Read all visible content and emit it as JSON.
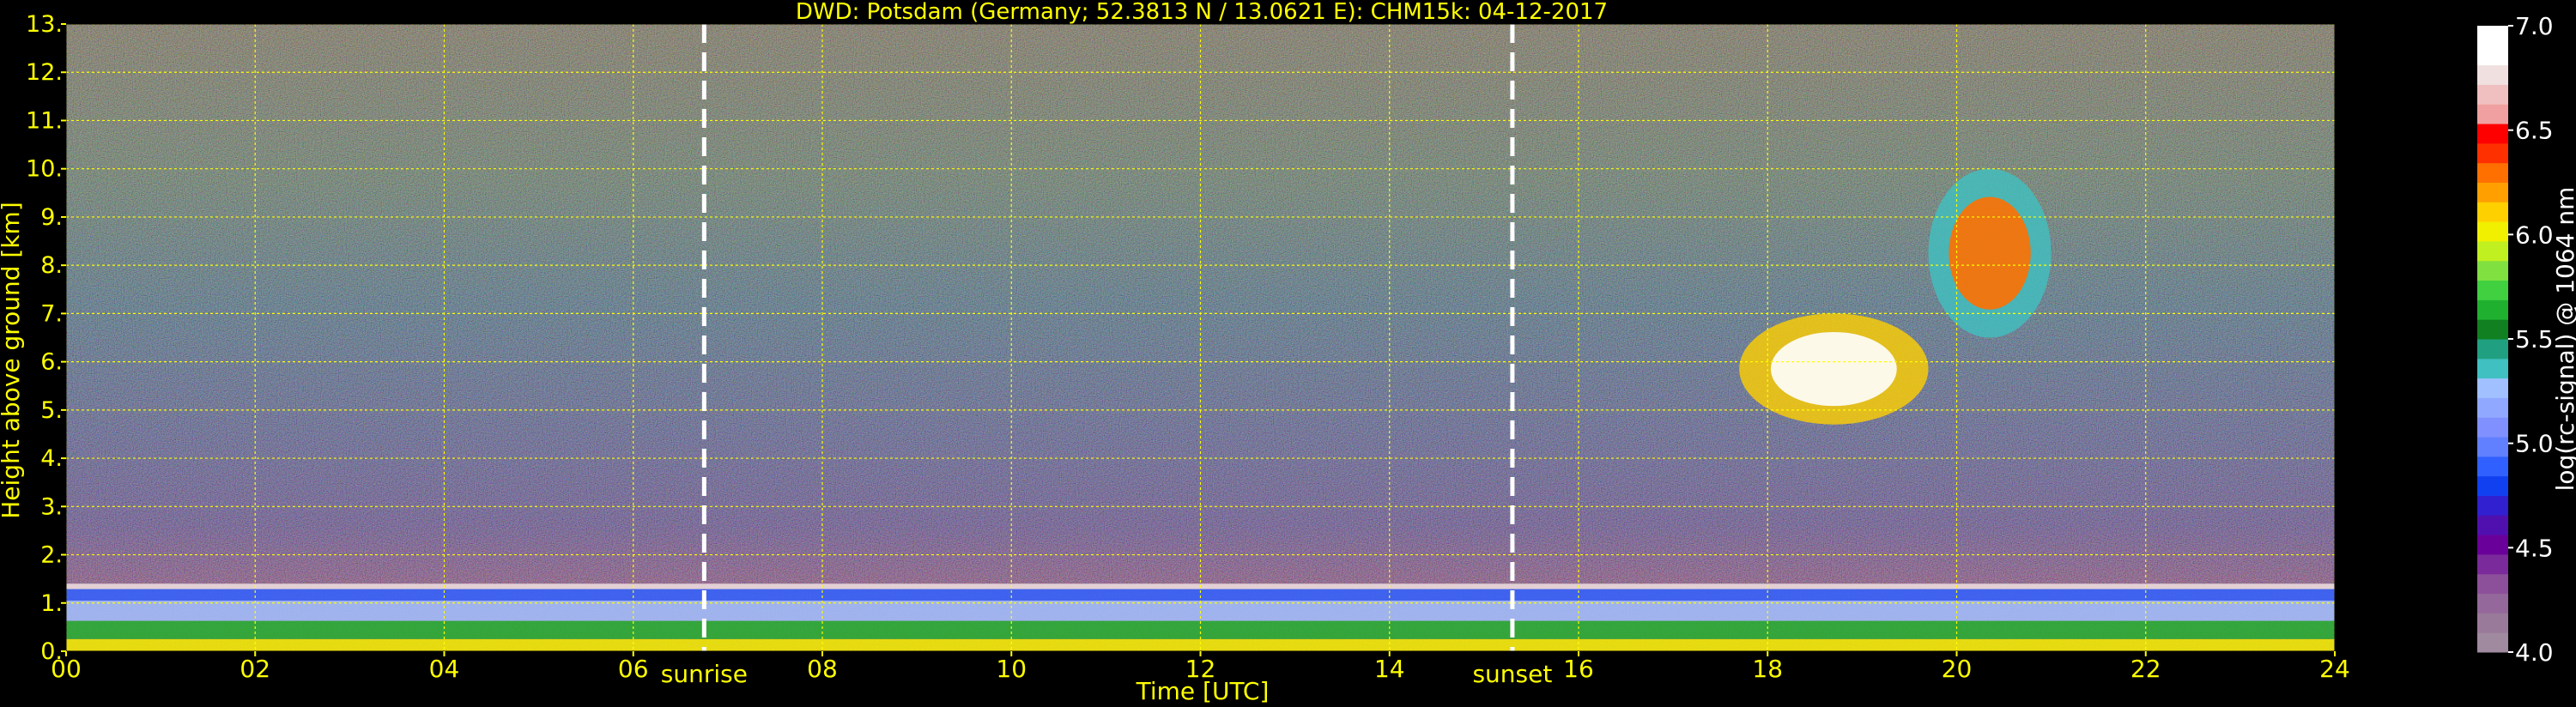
{
  "chart_data": {
    "type": "heatmap",
    "title": "DWD: Potsdam (Germany; 52.3813 N / 13.0621 E):    CHM15k: 04-12-2017",
    "xlabel": "Time [UTC]",
    "ylabel": "Height above ground [km]",
    "xlim": [
      0,
      24
    ],
    "ylim": [
      0,
      13
    ],
    "x_ticks": [
      0,
      2,
      4,
      6,
      8,
      10,
      12,
      14,
      16,
      18,
      20,
      22,
      24
    ],
    "x_tick_labels": [
      "00",
      "02",
      "04",
      "06",
      "08",
      "10",
      "12",
      "14",
      "16",
      "18",
      "20",
      "22",
      "24"
    ],
    "y_ticks": [
      0,
      1,
      2,
      3,
      4,
      5,
      6,
      7,
      8,
      9,
      10,
      11,
      12,
      13
    ],
    "y_tick_labels": [
      "0.",
      "1.",
      "2.",
      "3.",
      "4.",
      "5.",
      "6.",
      "7.",
      "8.",
      "9.",
      "10.",
      "11.",
      "12.",
      "13."
    ],
    "grid": true,
    "annotations": [
      {
        "label": "sunrise",
        "x": 6.75
      },
      {
        "label": "sunset",
        "x": 15.3
      }
    ],
    "colorbar": {
      "label": "log(rc-signal) @ 1064 nm",
      "range": [
        4.0,
        7.0
      ],
      "ticks": [
        4.0,
        4.5,
        5.0,
        5.5,
        6.0,
        6.5,
        7.0
      ],
      "tick_labels": [
        "4.0",
        "4.5",
        "5.0",
        "5.5",
        "6.0",
        "6.5",
        "7.0"
      ],
      "colors": [
        "#a08aa0",
        "#9a7a9a",
        "#94689a",
        "#8c509a",
        "#7a2a9a",
        "#6a009a",
        "#5010b0",
        "#3020d0",
        "#1040f0",
        "#3060ff",
        "#6080ff",
        "#8090ff",
        "#90a8ff",
        "#a0c0ff",
        "#40c0c0",
        "#20a080",
        "#108020",
        "#20b030",
        "#40d040",
        "#80e040",
        "#c0f020",
        "#f0f000",
        "#ffd000",
        "#ffa000",
        "#ff7000",
        "#ff3000",
        "#ff0000",
        "#f0a0a0",
        "#f0c0c0",
        "#f0e0e0",
        "#ffffff",
        "#ffffff"
      ]
    },
    "features": [
      {
        "name": "boundary layer",
        "start": 0,
        "end": 24,
        "top_km": 1.4,
        "peak": 6.8
      },
      {
        "name": "cloud",
        "start": 17.7,
        "end": 19.7,
        "bottom_km": 4.7,
        "top_km": 7.0,
        "peak": 7.0
      },
      {
        "name": "cloud",
        "start": 19.7,
        "end": 21.0,
        "bottom_km": 6.5,
        "top_km": 10.0,
        "peak": 6.3
      }
    ]
  }
}
